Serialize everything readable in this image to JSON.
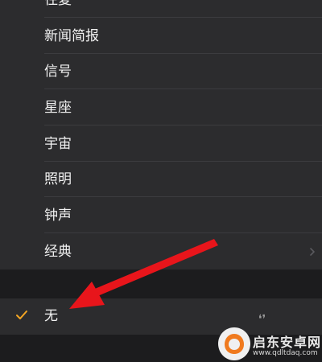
{
  "colors": {
    "background": "#1c1c1e",
    "cell": "#2c2c2e",
    "separator": "#3c3c3f",
    "text": "#f2f2f2",
    "checkmark": "#f5a623",
    "arrow": "#e8151b"
  },
  "tone_list": {
    "items": [
      {
        "label": "往复"
      },
      {
        "label": "新闻简报"
      },
      {
        "label": "信号"
      },
      {
        "label": "星座"
      },
      {
        "label": "宇宙"
      },
      {
        "label": "照明"
      },
      {
        "label": "钟声"
      },
      {
        "label": "经典",
        "icon": "chevron-right-icon"
      }
    ]
  },
  "none_option": {
    "label": "无",
    "selected": true,
    "icon": "checkmark-icon"
  },
  "annotation": {
    "icon": "red-arrow-icon"
  },
  "watermark": {
    "title": "启东安卓网",
    "url": "www.qdltdaq.com",
    "icon": "watermark-logo-icon"
  }
}
